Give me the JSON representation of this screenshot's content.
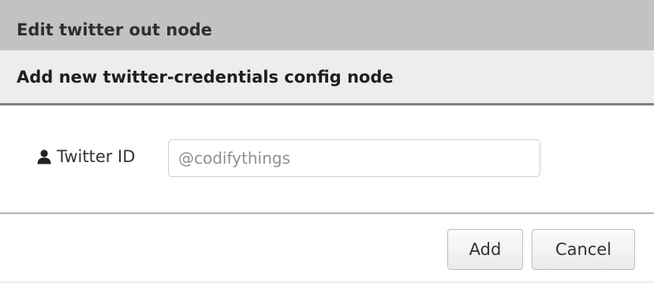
{
  "dialog": {
    "outer_title": "Edit twitter out node",
    "inner_title": "Add new twitter-credentials config node"
  },
  "form": {
    "twitter_id": {
      "icon": "user-icon",
      "label": "Twitter ID",
      "placeholder": "@codifythings",
      "value": ""
    }
  },
  "buttons": {
    "add_label": "Add",
    "cancel_label": "Cancel"
  },
  "colors": {
    "outer_header_bg": "#c2c2c2",
    "inner_header_bg": "#ededed",
    "inner_header_border": "#7e7e7e"
  }
}
